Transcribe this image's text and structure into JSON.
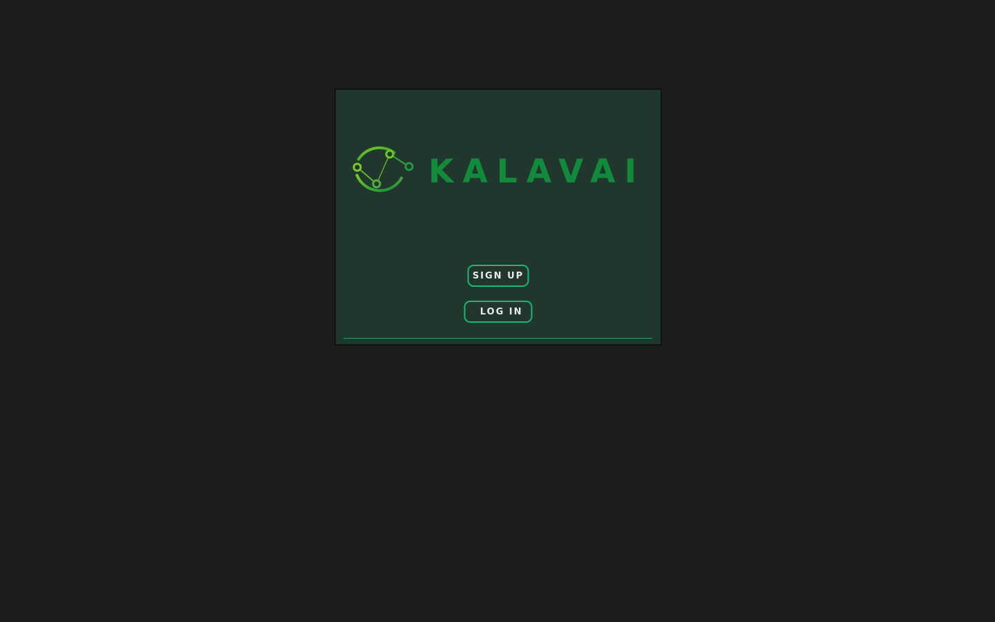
{
  "brand": {
    "name": "KALAVAI",
    "text_color": "#128a3c",
    "ring_colors": [
      "#6fc42b",
      "#128a3c"
    ]
  },
  "actions": {
    "signup_label": "SIGN UP",
    "login_label": "LOG IN",
    "login_icon": "user-icon"
  },
  "colors": {
    "page_background": "#1b1c1c",
    "card_background": "#21372d",
    "button_border": "#1bb778",
    "button_text": "#e8ece9"
  }
}
